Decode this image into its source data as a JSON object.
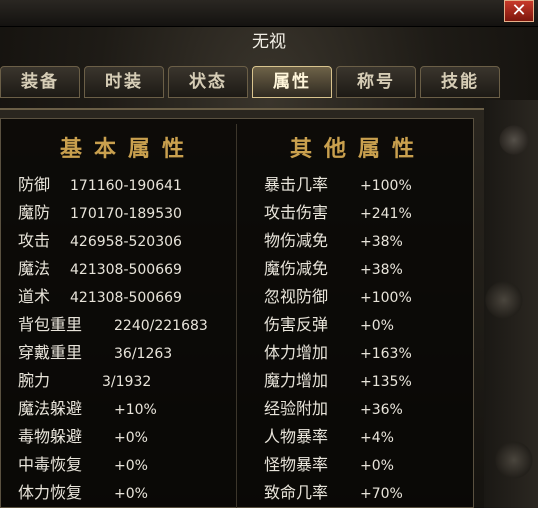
{
  "window": {
    "title": "无视",
    "close_label": "✕"
  },
  "tabs": [
    {
      "label": "装备"
    },
    {
      "label": "时装"
    },
    {
      "label": "状态"
    },
    {
      "label": "属性",
      "active": true
    },
    {
      "label": "称号"
    },
    {
      "label": "技能"
    }
  ],
  "basic": {
    "header": "基本属性",
    "rows": [
      {
        "label": "防御",
        "value": "171160-190641"
      },
      {
        "label": "魔防",
        "value": "170170-189530"
      },
      {
        "label": "攻击",
        "value": "426958-520306"
      },
      {
        "label": "魔法",
        "value": "421308-500669"
      },
      {
        "label": "道术",
        "value": "421308-500669"
      },
      {
        "label": "背包重里",
        "value": "2240/221683"
      },
      {
        "label": "穿戴重里",
        "value": "36/1263"
      },
      {
        "label": "腕力",
        "value": "3/1932"
      },
      {
        "label": "魔法躲避",
        "value": "+10%"
      },
      {
        "label": "毒物躲避",
        "value": "+0%"
      },
      {
        "label": "中毒恢复",
        "value": "+0%"
      },
      {
        "label": "体力恢复",
        "value": "+0%"
      }
    ]
  },
  "other": {
    "header": "其他属性",
    "rows": [
      {
        "label": "暴击几率",
        "value": "+100%"
      },
      {
        "label": "攻击伤害",
        "value": "+241%"
      },
      {
        "label": "物伤减免",
        "value": "+38%"
      },
      {
        "label": "魔伤减免",
        "value": "+38%"
      },
      {
        "label": "忽视防御",
        "value": "+100%"
      },
      {
        "label": "伤害反弹",
        "value": "+0%"
      },
      {
        "label": "体力增加",
        "value": "+163%"
      },
      {
        "label": "魔力增加",
        "value": "+135%"
      },
      {
        "label": "经验附加",
        "value": "+36%"
      },
      {
        "label": "人物暴率",
        "value": "+4%"
      },
      {
        "label": "怪物暴率",
        "value": "+0%"
      },
      {
        "label": "致命几率",
        "value": "+70%"
      }
    ]
  },
  "colors": {
    "header_gold": "#c9a04e",
    "text": "#e8e4da",
    "close_red": "#c83a2a"
  }
}
